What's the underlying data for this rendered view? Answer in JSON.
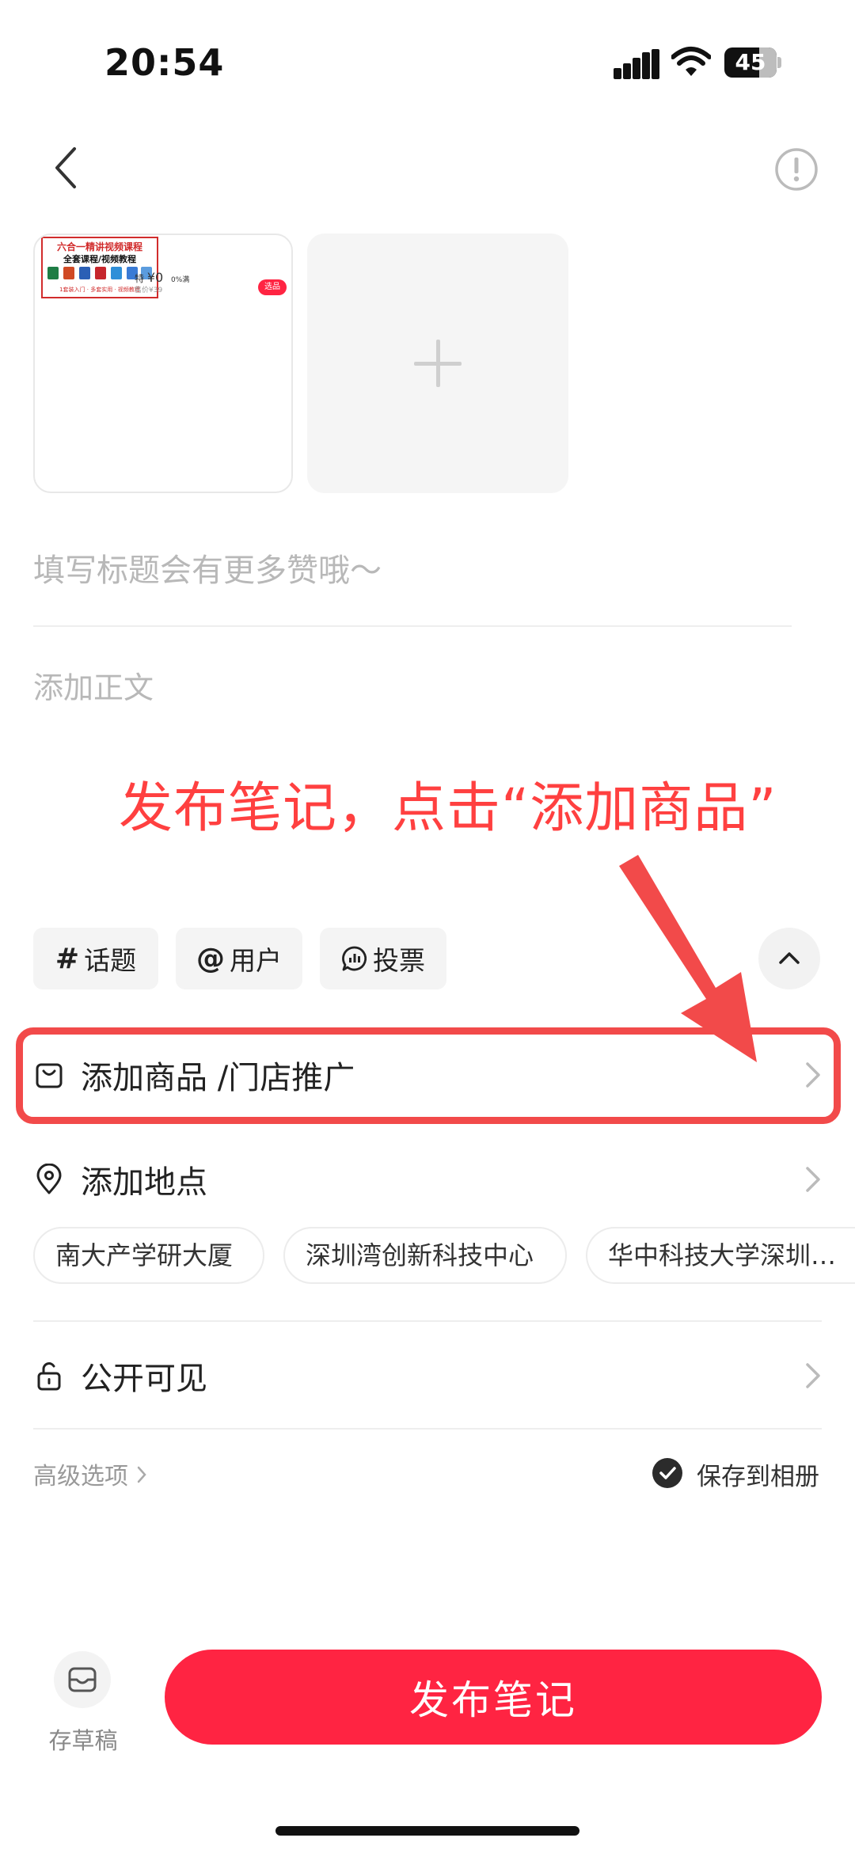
{
  "status_bar": {
    "time": "20:54",
    "battery": "45"
  },
  "media": {
    "thumbnail": {
      "line1": "六合一精讲视频课程",
      "line2": "全套课程/视频教程",
      "line3": "1套装入门 · 多套实用 · 视频教程",
      "price": "¥0",
      "price_prefix": "特",
      "discount": "0%满",
      "sold": "售价¥39",
      "tag": "选品"
    }
  },
  "editor": {
    "title_placeholder": "填写标题会有更多赞哦～",
    "body_placeholder": "添加正文"
  },
  "annotation": {
    "text": "发布笔记，点击“添加商品”"
  },
  "chips": [
    {
      "symbol": "#",
      "label": "话题"
    },
    {
      "symbol": "@",
      "label": "用户"
    },
    {
      "symbol": "vote-icon",
      "label": "投票"
    }
  ],
  "rows": {
    "product": "添加商品 /门店推广",
    "location": "添加地点",
    "visibility": "公开可见"
  },
  "locations": [
    "南大产学研大厦",
    "深圳湾创新科技中心",
    "华中科技大学深圳…"
  ],
  "options": {
    "advanced": "高级选项",
    "save_album": "保存到相册"
  },
  "bottom": {
    "draft": "存草稿",
    "publish": "发布笔记"
  },
  "colors": {
    "brand": "#ff2442",
    "annotation": "#ff4040"
  }
}
